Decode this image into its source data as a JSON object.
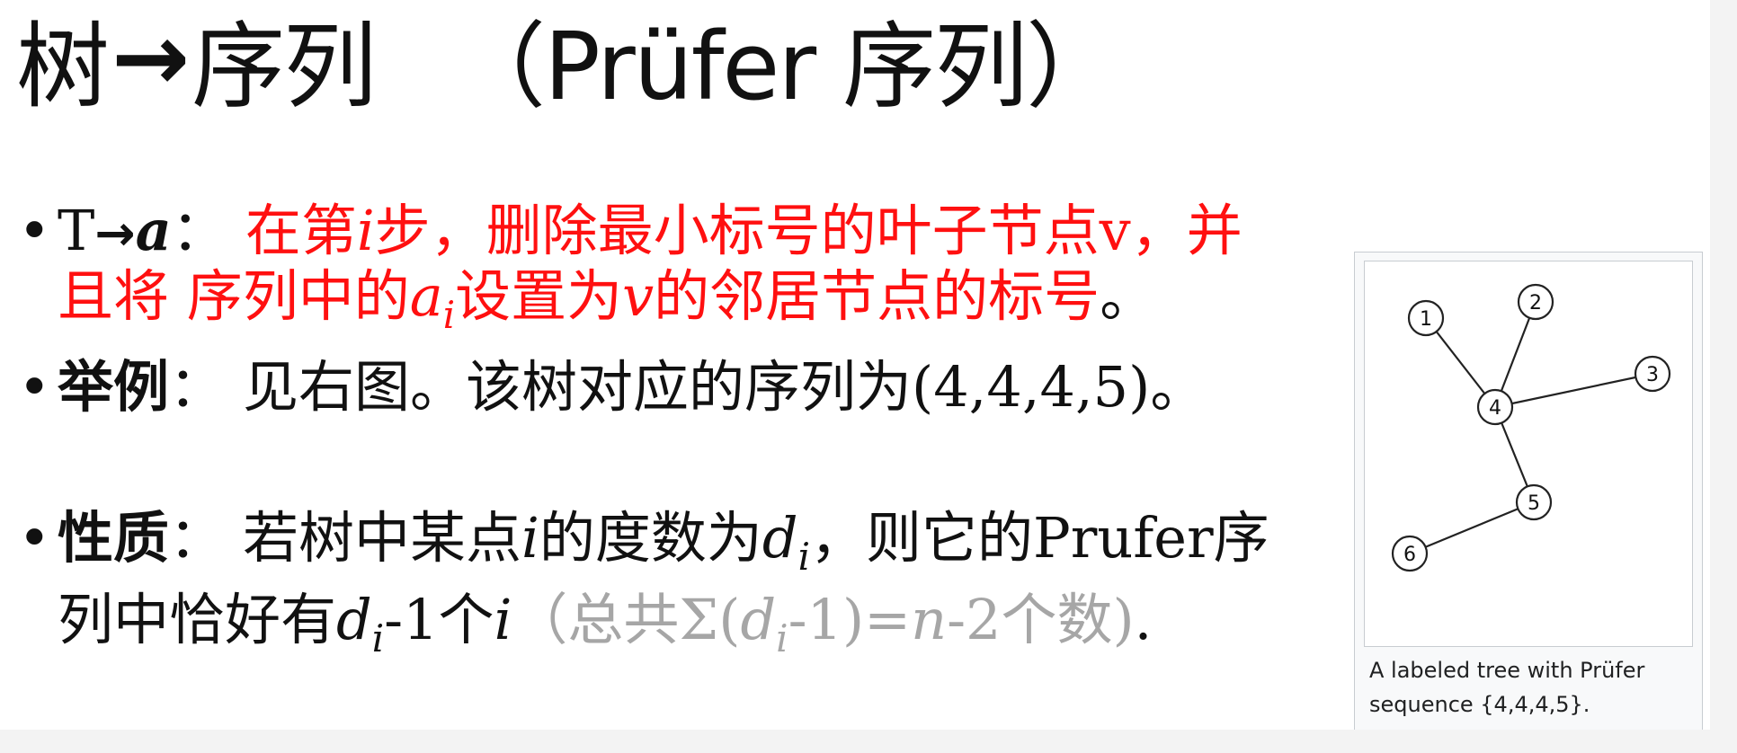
{
  "title": {
    "main": "树",
    "arrow": "→",
    "rest": "序列",
    "paren": "（Prüfer 序列）"
  },
  "bullet1": {
    "lead_T": "T",
    "lead_arrow": "→",
    "lead_a": "a",
    "colon": "：",
    "text1": "在第",
    "var_i": "i",
    "text2": "步，删除最小标号的叶子节点v，并且将 序列中的",
    "var_a": "a",
    "sub_i": "i",
    "text3": "设置为",
    "var_v": "v",
    "text4": "的邻居节点的标号",
    "period": "。"
  },
  "bullet2": {
    "label": "举例",
    "colon": "：",
    "text": "见右图。该树对应的序列为(4,4,4,5)。"
  },
  "bullet3": {
    "label": "性质",
    "colon": "：",
    "text1": "若树中某点",
    "var_i": "i",
    "text2": "的度数为",
    "var_d": "d",
    "sub_i": "i",
    "text3": "，则它的Prufer序列中恰好有",
    "var_d2": "d",
    "sub_i2": "i",
    "text4": "-1个",
    "var_i2": "i",
    "gray1": "（总共Σ(",
    "gray_d": "d",
    "gray_sub": "i",
    "gray2": "-1)=",
    "gray_n": "n",
    "gray3": "-2个数)",
    "end": "."
  },
  "tree": {
    "nodes": [
      {
        "label": "1"
      },
      {
        "label": "2"
      },
      {
        "label": "3"
      },
      {
        "label": "4"
      },
      {
        "label": "5"
      },
      {
        "label": "6"
      }
    ],
    "edges": [
      [
        "1",
        "4"
      ],
      [
        "2",
        "4"
      ],
      [
        "3",
        "4"
      ],
      [
        "4",
        "5"
      ],
      [
        "5",
        "6"
      ]
    ]
  },
  "caption": {
    "line1": "A labeled tree with Prüfer",
    "line2": "sequence {4,4,4,5}."
  }
}
